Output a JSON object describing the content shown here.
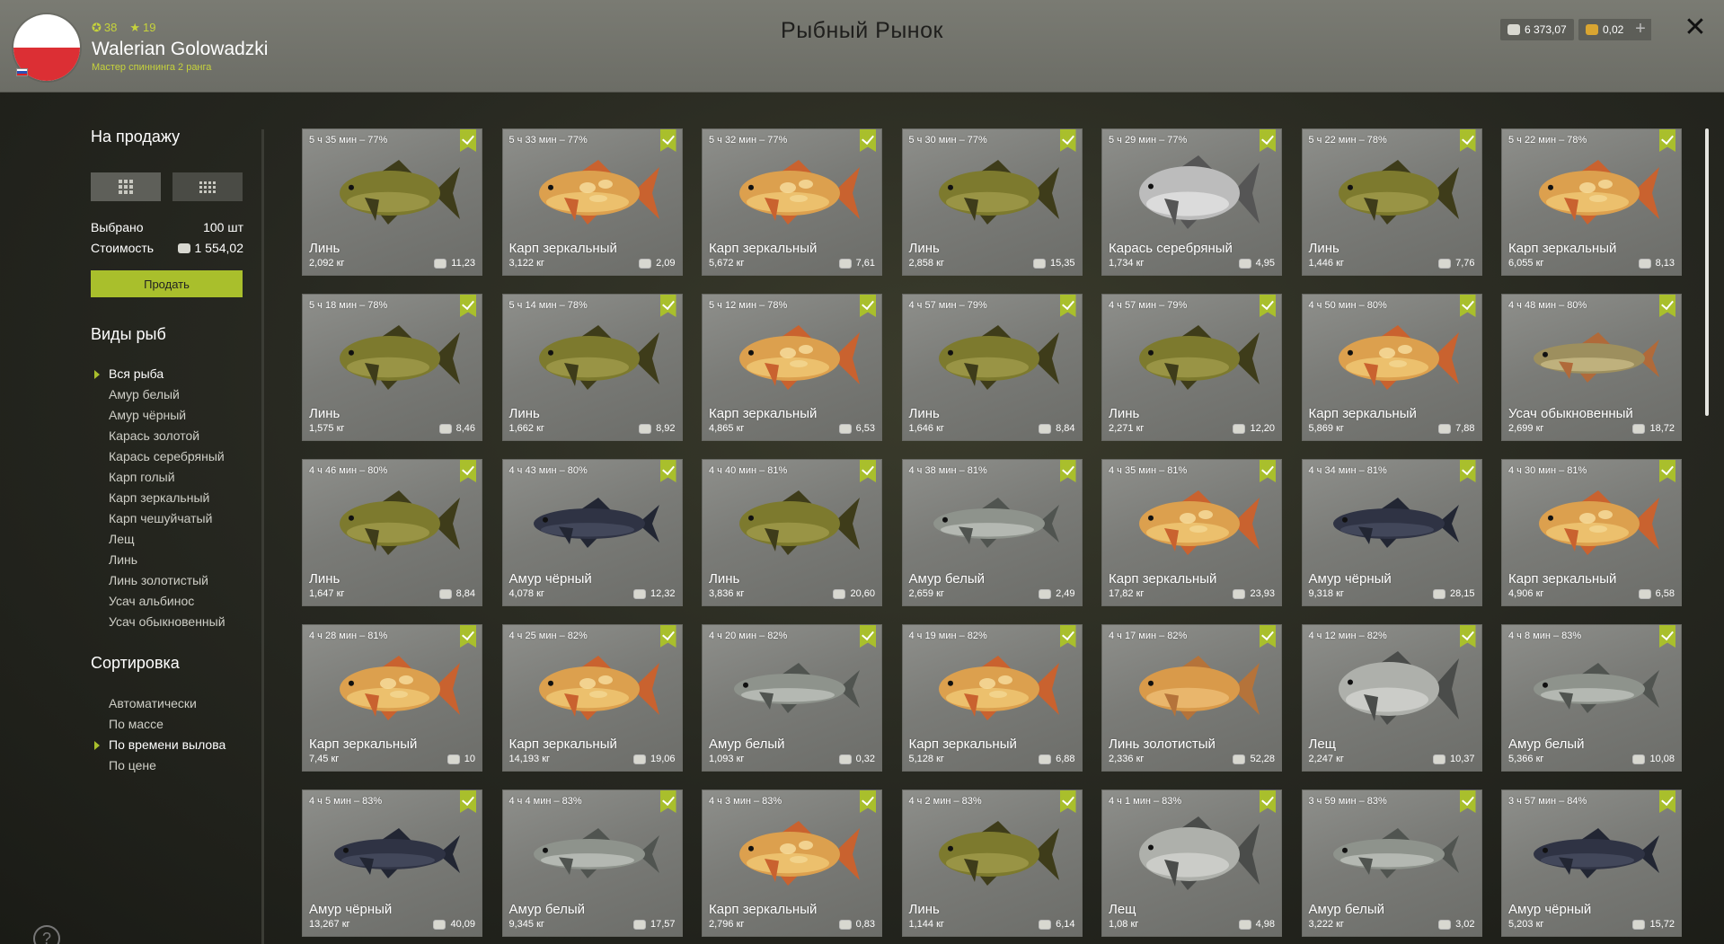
{
  "header": {
    "title": "Рыбный Рынок",
    "player": {
      "name": "Walerian Golowadzki",
      "rank": "Мастер спиннинга 2 ранга",
      "level": "38",
      "stars": "19"
    },
    "silver": "6 373,07",
    "gold": "0,02",
    "plus": "+",
    "close": "✕"
  },
  "sidebar": {
    "for_sale_title": "На продажу",
    "selected_label": "Выбрано",
    "selected_value": "100 шт",
    "cost_label": "Стоимость",
    "cost_value": "1 554,02",
    "sell_button": "Продать",
    "species_title": "Виды рыб",
    "species": [
      "Вся рыба",
      "Амур белый",
      "Амур чёрный",
      "Карась золотой",
      "Карась серебряный",
      "Карп голый",
      "Карп зеркальный",
      "Карп чешуйчатый",
      "Лещ",
      "Линь",
      "Линь золотистый",
      "Усач альбинос",
      "Усач обыкновенный"
    ],
    "species_active": "Вся рыба",
    "sort_title": "Сортировка",
    "sort_options": [
      "Автоматически",
      "По массе",
      "По времени вылова",
      "По цене"
    ],
    "sort_active": "По времени вылова",
    "help": "?"
  },
  "colors": {
    "accent": "#a9bf2c",
    "header_bg": "#73746d",
    "card_bg": "#7e7f7b"
  },
  "fish_palette": {
    "tench": {
      "body": "#7d7a2e",
      "belly": "#a5a050",
      "fin": "#3e3c1a"
    },
    "mirror": {
      "body": "#dca04e",
      "belly": "#f2cd7a",
      "fin": "#c9622f"
    },
    "silver": {
      "body": "#bcbcbc",
      "belly": "#e8e8e8",
      "fin": "#555555"
    },
    "white": {
      "body": "#8e938c",
      "belly": "#c5c8c2",
      "fin": "#505450"
    },
    "black": {
      "body": "#2f3344",
      "belly": "#4a5064",
      "fin": "#222633"
    },
    "barbel": {
      "body": "#9d8f5e",
      "belly": "#cdbf8a",
      "fin": "#b06a3a"
    },
    "golden": {
      "body": "#d99a4a",
      "belly": "#f0c27a",
      "fin": "#b5733a"
    },
    "bream": {
      "body": "#aeb0ab",
      "belly": "#d7d8d4",
      "fin": "#4a4c4a"
    }
  },
  "cards": [
    {
      "time": "5 ч 35 мин – 77%",
      "name": "Линь",
      "weight": "2,092 кг",
      "price": "11,23",
      "fish": "tench"
    },
    {
      "time": "5 ч 33 мин – 77%",
      "name": "Карп зеркальный",
      "weight": "3,122 кг",
      "price": "2,09",
      "fish": "mirror"
    },
    {
      "time": "5 ч 32 мин – 77%",
      "name": "Карп зеркальный",
      "weight": "5,672 кг",
      "price": "7,61",
      "fish": "mirror"
    },
    {
      "time": "5 ч 30 мин – 77%",
      "name": "Линь",
      "weight": "2,858 кг",
      "price": "15,35",
      "fish": "tench"
    },
    {
      "time": "5 ч 29 мин – 77%",
      "name": "Карась серебряный",
      "weight": "1,734 кг",
      "price": "4,95",
      "fish": "silver"
    },
    {
      "time": "5 ч 22 мин – 78%",
      "name": "Линь",
      "weight": "1,446 кг",
      "price": "7,76",
      "fish": "tench"
    },
    {
      "time": "5 ч 22 мин – 78%",
      "name": "Карп зеркальный",
      "weight": "6,055 кг",
      "price": "8,13",
      "fish": "mirror"
    },
    {
      "time": "5 ч 18 мин – 78%",
      "name": "Линь",
      "weight": "1,575 кг",
      "price": "8,46",
      "fish": "tench"
    },
    {
      "time": "5 ч 14 мин – 78%",
      "name": "Линь",
      "weight": "1,662 кг",
      "price": "8,92",
      "fish": "tench"
    },
    {
      "time": "5 ч 12 мин – 78%",
      "name": "Карп зеркальный",
      "weight": "4,865 кг",
      "price": "6,53",
      "fish": "mirror"
    },
    {
      "time": "4 ч 57 мин – 79%",
      "name": "Линь",
      "weight": "1,646 кг",
      "price": "8,84",
      "fish": "tench"
    },
    {
      "time": "4 ч 57 мин – 79%",
      "name": "Линь",
      "weight": "2,271 кг",
      "price": "12,20",
      "fish": "tench"
    },
    {
      "time": "4 ч 50 мин – 80%",
      "name": "Карп зеркальный",
      "weight": "5,869 кг",
      "price": "7,88",
      "fish": "mirror"
    },
    {
      "time": "4 ч 48 мин – 80%",
      "name": "Усач обыкновенный",
      "weight": "2,699 кг",
      "price": "18,72",
      "fish": "barbel"
    },
    {
      "time": "4 ч 46 мин – 80%",
      "name": "Линь",
      "weight": "1,647 кг",
      "price": "8,84",
      "fish": "tench"
    },
    {
      "time": "4 ч 43 мин – 80%",
      "name": "Амур чёрный",
      "weight": "4,078 кг",
      "price": "12,32",
      "fish": "black"
    },
    {
      "time": "4 ч 40 мин – 81%",
      "name": "Линь",
      "weight": "3,836 кг",
      "price": "20,60",
      "fish": "tench"
    },
    {
      "time": "4 ч 38 мин – 81%",
      "name": "Амур белый",
      "weight": "2,659 кг",
      "price": "2,49",
      "fish": "white"
    },
    {
      "time": "4 ч 35 мин – 81%",
      "name": "Карп зеркальный",
      "weight": "17,82 кг",
      "price": "23,93",
      "fish": "mirror"
    },
    {
      "time": "4 ч 34 мин – 81%",
      "name": "Амур чёрный",
      "weight": "9,318 кг",
      "price": "28,15",
      "fish": "black"
    },
    {
      "time": "4 ч 30 мин – 81%",
      "name": "Карп зеркальный",
      "weight": "4,906 кг",
      "price": "6,58",
      "fish": "mirror"
    },
    {
      "time": "4 ч 28 мин – 81%",
      "name": "Карп зеркальный",
      "weight": "7,45 кг",
      "price": "10",
      "fish": "mirror"
    },
    {
      "time": "4 ч 25 мин – 82%",
      "name": "Карп зеркальный",
      "weight": "14,193 кг",
      "price": "19,06",
      "fish": "mirror"
    },
    {
      "time": "4 ч 20 мин – 82%",
      "name": "Амур белый",
      "weight": "1,093 кг",
      "price": "0,32",
      "fish": "white"
    },
    {
      "time": "4 ч 19 мин – 82%",
      "name": "Карп зеркальный",
      "weight": "5,128 кг",
      "price": "6,88",
      "fish": "mirror"
    },
    {
      "time": "4 ч 17 мин – 82%",
      "name": "Линь золотистый",
      "weight": "2,336 кг",
      "price": "52,28",
      "fish": "golden"
    },
    {
      "time": "4 ч 12 мин – 82%",
      "name": "Лещ",
      "weight": "2,247 кг",
      "price": "10,37",
      "fish": "bream"
    },
    {
      "time": "4 ч 8 мин – 83%",
      "name": "Амур белый",
      "weight": "5,366 кг",
      "price": "10,08",
      "fish": "white"
    },
    {
      "time": "4 ч 5 мин – 83%",
      "name": "Амур чёрный",
      "weight": "13,267 кг",
      "price": "40,09",
      "fish": "black"
    },
    {
      "time": "4 ч 4 мин – 83%",
      "name": "Амур белый",
      "weight": "9,345 кг",
      "price": "17,57",
      "fish": "white"
    },
    {
      "time": "4 ч 3 мин – 83%",
      "name": "Карп зеркальный",
      "weight": "2,796 кг",
      "price": "0,83",
      "fish": "mirror"
    },
    {
      "time": "4 ч 2 мин – 83%",
      "name": "Линь",
      "weight": "1,144 кг",
      "price": "6,14",
      "fish": "tench"
    },
    {
      "time": "4 ч 1 мин – 83%",
      "name": "Лещ",
      "weight": "1,08 кг",
      "price": "4,98",
      "fish": "bream"
    },
    {
      "time": "3 ч 59 мин – 83%",
      "name": "Амур белый",
      "weight": "3,222 кг",
      "price": "3,02",
      "fish": "white"
    },
    {
      "time": "3 ч 57 мин – 84%",
      "name": "Амур чёрный",
      "weight": "5,203 кг",
      "price": "15,72",
      "fish": "black"
    }
  ]
}
